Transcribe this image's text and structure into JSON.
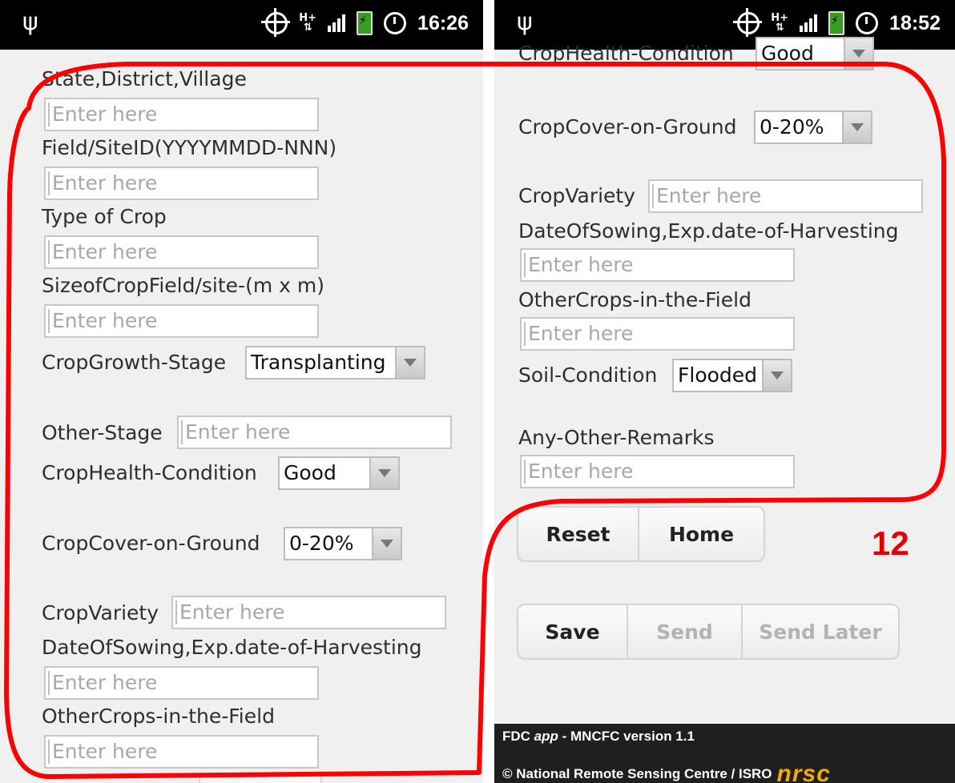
{
  "left_screen": {
    "status": {
      "time": "16:26"
    },
    "labels": {
      "location": "State,District,Village",
      "site_id": "Field/SiteID(YYYYMMDD-NNN)",
      "crop_type": "Type of Crop",
      "field_size": "SizeofCropField/site-(m x m)",
      "growth_stage": "CropGrowth-Stage",
      "other_stage": "Other-Stage",
      "health": "CropHealth-Condition",
      "cover": "CropCover-on-Ground",
      "variety": "CropVariety",
      "sowing": "DateOfSowing,Exp.date-of-Harvesting",
      "other_crops": "OtherCrops-in-the-Field"
    },
    "placeholder": "Enter here",
    "selects": {
      "growth_stage": "Transplanting",
      "health": "Good",
      "cover": "0-20%"
    }
  },
  "right_screen": {
    "status": {
      "time": "18:52"
    },
    "labels": {
      "health_partial": "CropHealth-Condition",
      "cover": "CropCover-on-Ground",
      "variety": "CropVariety",
      "sowing": "DateOfSowing,Exp.date-of-Harvesting",
      "other_crops": "OtherCrops-in-the-Field",
      "soil": "Soil-Condition",
      "remarks": "Any-Other-Remarks"
    },
    "placeholder": "Enter here",
    "selects": {
      "health_partial": "Good",
      "cover": "0-20%",
      "soil": "Flooded"
    },
    "buttons": {
      "reset": "Reset",
      "home": "Home",
      "save": "Save",
      "send": "Send",
      "send_later": "Send Later"
    },
    "footer": {
      "app_prefix": "FDC ",
      "app_italic": "app",
      "app_suffix": " - MNCFC version 1.1",
      "credit": "© National Remote Sensing Centre / ISRO",
      "logo_text": "nrsc"
    }
  },
  "annotation": {
    "number": "12",
    "color": "#e30000"
  }
}
